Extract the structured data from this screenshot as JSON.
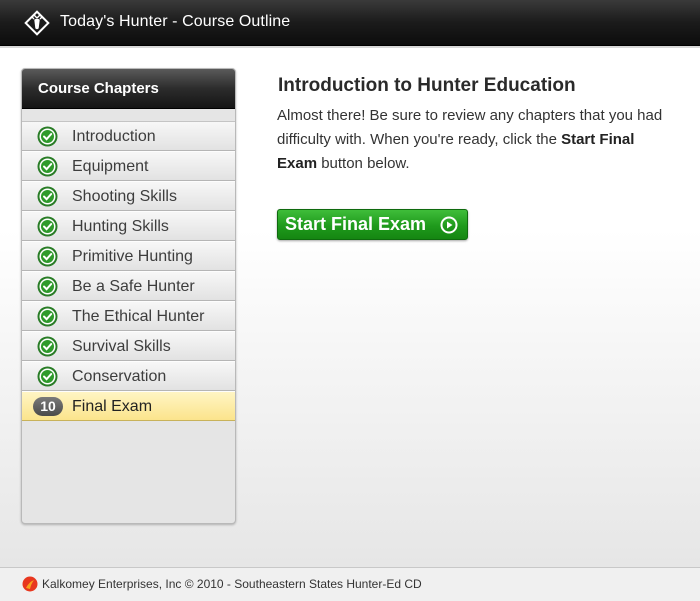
{
  "header": {
    "title": "Today's Hunter - Course Outline",
    "logo_icon": "deer-head-logo-icon"
  },
  "sidebar": {
    "heading": "Course Chapters",
    "chapters": [
      {
        "label": "Introduction",
        "status": "complete",
        "icon": "check-icon"
      },
      {
        "label": "Equipment",
        "status": "complete",
        "icon": "check-icon"
      },
      {
        "label": "Shooting Skills",
        "status": "complete",
        "icon": "check-icon"
      },
      {
        "label": "Hunting Skills",
        "status": "complete",
        "icon": "check-icon"
      },
      {
        "label": "Primitive Hunting",
        "status": "complete",
        "icon": "check-icon"
      },
      {
        "label": "Be a Safe Hunter",
        "status": "complete",
        "icon": "check-icon"
      },
      {
        "label": "The Ethical Hunter",
        "status": "complete",
        "icon": "check-icon"
      },
      {
        "label": "Survival Skills",
        "status": "complete",
        "icon": "check-icon"
      },
      {
        "label": "Conservation",
        "status": "complete",
        "icon": "check-icon"
      },
      {
        "label": "Final Exam",
        "status": "current",
        "number": "10"
      }
    ]
  },
  "content": {
    "title": "Introduction to Hunter Education",
    "body_part1": "Almost there!  Be sure to review any chapters that you had difficulty with.  When you're ready, click the ",
    "body_bold": "Start Final Exam",
    "body_part2": " button below.",
    "start_button_label": "Start Final Exam",
    "start_button_icon": "play-circle-icon"
  },
  "footer": {
    "copyright": "Kalkomey Enterprises, Inc © 2010 - Southeastern States Hunter-Ed CD",
    "logo_icon": "kalkomey-logo-icon"
  },
  "colors": {
    "header_bg": "#1b1b1b",
    "accent_green": "#1f9a1c",
    "active_chapter": "#fbe48c",
    "check_green": "#2e9a2a"
  }
}
